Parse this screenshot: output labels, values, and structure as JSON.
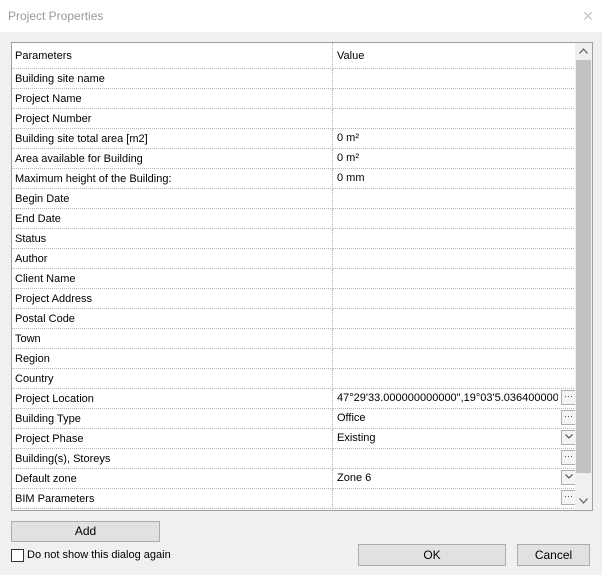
{
  "window": {
    "title": "Project Properties",
    "close_glyph": "✕"
  },
  "grid": {
    "headers": {
      "param": "Parameters",
      "value": "Value"
    },
    "rows": [
      {
        "param": "Building site name",
        "value": ""
      },
      {
        "param": "Project Name",
        "value": ""
      },
      {
        "param": "Project Number",
        "value": ""
      },
      {
        "param": "Building site total area [m2]",
        "value": "0 m²"
      },
      {
        "param": "Area available for Building",
        "value": "0 m²"
      },
      {
        "param": "Maximum height of the Building:",
        "value": "0 mm"
      },
      {
        "param": "Begin Date",
        "value": ""
      },
      {
        "param": "End Date",
        "value": ""
      },
      {
        "param": "Status",
        "value": ""
      },
      {
        "param": "Author",
        "value": ""
      },
      {
        "param": "Client Name",
        "value": ""
      },
      {
        "param": "Project Address",
        "value": ""
      },
      {
        "param": "Postal Code",
        "value": ""
      },
      {
        "param": "Town",
        "value": ""
      },
      {
        "param": "Region",
        "value": ""
      },
      {
        "param": "Country",
        "value": ""
      },
      {
        "param": "Project Location",
        "value": "47°29'33.000000000000\",19°03'5.036400000",
        "editor": "ellipsis"
      },
      {
        "param": "Building Type",
        "value": "Office",
        "editor": "ellipsis"
      },
      {
        "param": "Project Phase",
        "value": "Existing",
        "editor": "dropdown"
      },
      {
        "param": "Building(s), Storeys",
        "value": "",
        "editor": "ellipsis"
      },
      {
        "param": "Default zone",
        "value": "Zone 6",
        "editor": "dropdown"
      },
      {
        "param": "BIM Parameters",
        "value": "",
        "editor": "ellipsis"
      }
    ],
    "ellipsis_glyph": "···",
    "icons": {
      "ellipsis": "ellipsis-icon",
      "dropdown": "chevron-down-icon",
      "scroll_up": "chevron-up-icon",
      "scroll_down": "chevron-down-icon"
    }
  },
  "footer": {
    "add_label": "Add",
    "checkbox_label": "Do not show this dialog again",
    "checkbox_checked": false,
    "ok_label": "OK",
    "cancel_label": "Cancel"
  }
}
